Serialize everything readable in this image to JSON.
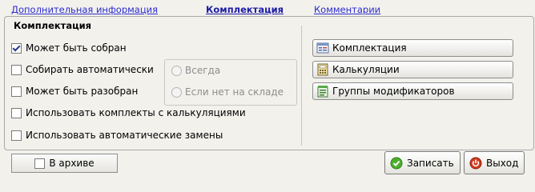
{
  "tabs": [
    {
      "label": "Дополнительная информация",
      "active": false
    },
    {
      "label": "Комплектация",
      "active": true
    },
    {
      "label": "Комментарии",
      "active": false
    }
  ],
  "group_title": "Комплектация",
  "options": {
    "can_be_assembled": {
      "label": "Может быть собран",
      "checked": true
    },
    "assemble_auto": {
      "label": "Собирать автоматически",
      "checked": false
    },
    "can_be_disassembled": {
      "label": "Может быть разобран",
      "checked": false
    },
    "use_kits_with_calc": {
      "label": "Использовать комплекты с калькуляциями",
      "checked": false
    },
    "use_auto_replacements": {
      "label": "Использовать автоматические замены",
      "checked": false
    }
  },
  "radio_options": {
    "always": {
      "label": "Всегда",
      "selected": false,
      "enabled": false
    },
    "if_not_in_stock": {
      "label": "Если нет на складе",
      "selected": false,
      "enabled": false
    }
  },
  "side_buttons": {
    "kit": {
      "label": "Комплектация",
      "icon": "kit-list-icon"
    },
    "calculations": {
      "label": "Калькуляции",
      "icon": "calculator-icon"
    },
    "modifier_groups": {
      "label": "Группы модификаторов",
      "icon": "modifier-groups-icon"
    }
  },
  "footer": {
    "archive": {
      "label": "В архиве",
      "checked": false
    },
    "save_label": "Записать",
    "exit_label": "Выход"
  },
  "colors": {
    "tab_link": "#2b2bd0",
    "background": "#f2f1ec",
    "save_icon": "#4caf2c",
    "exit_icon": "#d03a1e"
  }
}
